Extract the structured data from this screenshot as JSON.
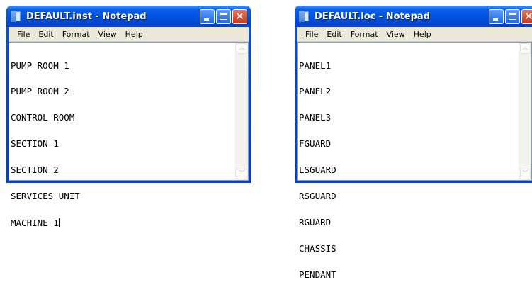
{
  "windows": [
    {
      "title": "DEFAULT.inst - Notepad",
      "menu": [
        "File",
        "Edit",
        "Format",
        "View",
        "Help"
      ],
      "menu_mnemonics": [
        "F",
        "E",
        "o",
        "V",
        "H"
      ],
      "lines": [
        "PUMP ROOM 1",
        "PUMP ROOM 2",
        "CONTROL ROOM",
        "SECTION 1",
        "SECTION 2",
        "SERVICES UNIT",
        "MACHINE 1"
      ]
    },
    {
      "title": "DEFAULT.loc - Notepad",
      "menu": [
        "File",
        "Edit",
        "Format",
        "View",
        "Help"
      ],
      "menu_mnemonics": [
        "F",
        "E",
        "o",
        "V",
        "H"
      ],
      "lines": [
        "PANEL1",
        "PANEL2",
        "PANEL3",
        "FGUARD",
        "LSGUARD",
        "RSGUARD",
        "RGUARD",
        "CHASSIS",
        "PENDANT"
      ]
    }
  ],
  "icons": {
    "app": "notepad-icon",
    "minimize": "minimize-icon",
    "maximize": "maximize-icon",
    "close": "close-icon",
    "scroll_up": "scroll-up-arrow-icon",
    "scroll_down": "scroll-down-arrow-icon"
  },
  "colors": {
    "titlebar": "#0054e3",
    "close_button": "#c4391c",
    "menubar": "#ece9d8",
    "editor_bg": "#ffffff"
  }
}
